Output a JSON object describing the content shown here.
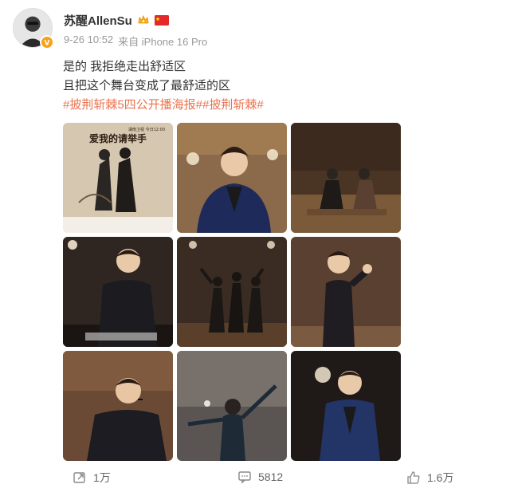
{
  "post": {
    "author": {
      "name": "苏醒AllenSu",
      "avatar": "avatar",
      "badges": [
        "crown-icon",
        "china-flag-icon"
      ],
      "verified": "verified-badge-icon"
    },
    "timestamp": "9-26 10:52",
    "source": "来自 iPhone 16 Pro",
    "text_lines": [
      "是的 我拒绝走出舒适区",
      "且把这个舞台变成了最舒适的区"
    ],
    "hashtags": "#披荆斩棘5四公开播海报##披荆斩棘#",
    "poster_title": "爱我的请举手",
    "poster_small": "湖南卫视 今日12:00",
    "actions": {
      "repost_count": "1万",
      "comment_count": "5812",
      "like_count": "1.6万"
    }
  },
  "colors": {
    "hashtag": "#eb7350",
    "meta": "#999999",
    "text": "#333333",
    "verified": "#f7a21b"
  }
}
